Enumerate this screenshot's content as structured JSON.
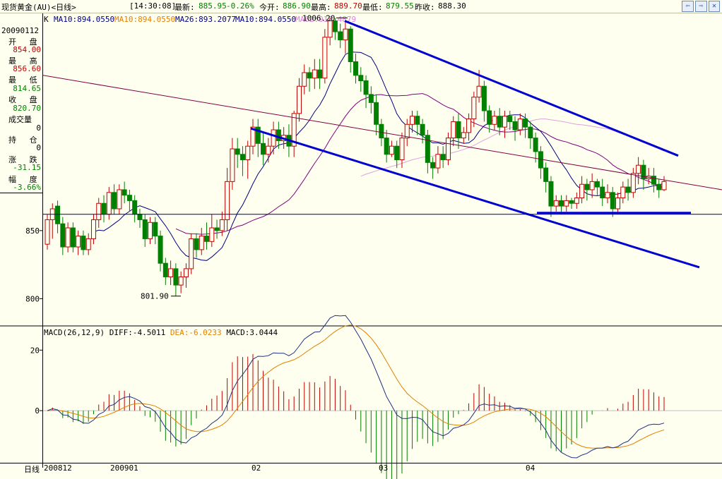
{
  "header": {
    "instrument": "现货黄金(AU)<日线>",
    "time": "[14:30:08]",
    "latest_label": "最新:",
    "latest_value": "885.95",
    "change_value": "-0.26%",
    "open_label": "今开:",
    "open_value": "886.90",
    "high_label": "最高:",
    "high_value": "889.70",
    "low_label": "最低:",
    "low_value": "879.55",
    "prev_label": "昨收:",
    "prev_value": "888.30"
  },
  "info_panel": {
    "date": "20090112",
    "open_label": "开 盘",
    "open_value": "854.00",
    "high_label": "最 高",
    "high_value": "856.60",
    "low_label": "最 低",
    "low_value": "814.65",
    "close_label": "收 盘",
    "close_value": "820.70",
    "volume_label": "成交量",
    "volume_value": "0",
    "oi_label": "持 仓",
    "oi_value": "0",
    "change_label": "涨 跌",
    "change_value": "-31.15",
    "amplitude_label": "幅 度",
    "amplitude_value": "-3.66%"
  },
  "ma_legend": [
    {
      "text": "K",
      "color": "#000000"
    },
    {
      "text": "MA10:894.0550",
      "color": "#000080"
    },
    {
      "text": "MA10:894.0550",
      "color": "#e08000"
    },
    {
      "text": "MA26:893.2077",
      "color": "#000080"
    },
    {
      "text": "MA10:894.0550",
      "color": "#000080"
    },
    {
      "text": "MA62:918.4879",
      "color": "#e080e0"
    }
  ],
  "macd_legend": {
    "name": "MACD(26,12,9)",
    "diff": "DIFF:-4.5011",
    "dea": "DEA:-6.0233",
    "macd": "MACD:3.0444"
  },
  "bottom_bar": {
    "period": "日线",
    "dates": [
      "200812",
      "200901",
      "02",
      "03",
      "04"
    ]
  },
  "chart_data": {
    "type": "candlestick",
    "price_axis": {
      "ticks": [
        800,
        850
      ],
      "ylim": [
        780,
        1010
      ]
    },
    "macd_axis": {
      "ticks": [
        0,
        20
      ],
      "ylim": [
        -17,
        28
      ]
    },
    "annotations": [
      {
        "text": "1006.20",
        "value": 1006.2
      },
      {
        "text": "801.90",
        "value": 801.9
      }
    ],
    "candles": [
      [
        840,
        858,
        836,
        862
      ],
      [
        858,
        866,
        844,
        870
      ],
      [
        868,
        855,
        848,
        872
      ],
      [
        855,
        838,
        832,
        860
      ],
      [
        838,
        852,
        834,
        856
      ],
      [
        852,
        838,
        834,
        856
      ],
      [
        838,
        846,
        832,
        850
      ],
      [
        846,
        836,
        832,
        850
      ],
      [
        836,
        844,
        832,
        848
      ],
      [
        844,
        858,
        840,
        862
      ],
      [
        858,
        870,
        852,
        874
      ],
      [
        870,
        862,
        856,
        876
      ],
      [
        862,
        878,
        858,
        882
      ],
      [
        878,
        866,
        862,
        884
      ],
      [
        866,
        880,
        862,
        884
      ],
      [
        880,
        876,
        870,
        886
      ],
      [
        876,
        872,
        864,
        880
      ],
      [
        872,
        862,
        856,
        876
      ],
      [
        862,
        858,
        852,
        866
      ],
      [
        858,
        844,
        838,
        862
      ],
      [
        844,
        856,
        840,
        860
      ],
      [
        856,
        846,
        840,
        860
      ],
      [
        846,
        826,
        820,
        850
      ],
      [
        826,
        816,
        810,
        830
      ],
      [
        816,
        822,
        810,
        828
      ],
      [
        822,
        810,
        802,
        826
      ],
      [
        810,
        816,
        804,
        820
      ],
      [
        816,
        822,
        808,
        826
      ],
      [
        822,
        844,
        818,
        848
      ],
      [
        844,
        836,
        830,
        848
      ],
      [
        836,
        846,
        832,
        852
      ],
      [
        846,
        842,
        836,
        856
      ],
      [
        842,
        852,
        838,
        862
      ],
      [
        852,
        850,
        844,
        858
      ],
      [
        850,
        858,
        846,
        864
      ],
      [
        858,
        886,
        850,
        896
      ],
      [
        886,
        910,
        880,
        918
      ],
      [
        910,
        906,
        896,
        918
      ],
      [
        906,
        902,
        890,
        912
      ],
      [
        902,
        912,
        888,
        916
      ],
      [
        912,
        926,
        906,
        932
      ],
      [
        926,
        914,
        904,
        932
      ],
      [
        914,
        906,
        898,
        922
      ],
      [
        906,
        912,
        900,
        918
      ],
      [
        912,
        924,
        906,
        930
      ],
      [
        924,
        916,
        910,
        930
      ],
      [
        916,
        920,
        910,
        926
      ],
      [
        920,
        912,
        904,
        928
      ],
      [
        912,
        936,
        904,
        938
      ],
      [
        936,
        956,
        930,
        962
      ],
      [
        956,
        966,
        950,
        972
      ],
      [
        966,
        962,
        952,
        970
      ],
      [
        962,
        968,
        954,
        976
      ],
      [
        968,
        962,
        954,
        976
      ],
      [
        962,
        992,
        958,
        998
      ],
      [
        992,
        1004,
        986,
        1006
      ],
      [
        1004,
        996,
        990,
        1006
      ],
      [
        996,
        990,
        984,
        1002
      ],
      [
        990,
        998,
        980,
        1004
      ],
      [
        998,
        974,
        966,
        1000
      ],
      [
        974,
        964,
        958,
        980
      ],
      [
        964,
        960,
        952,
        970
      ],
      [
        960,
        950,
        940,
        964
      ],
      [
        950,
        944,
        936,
        956
      ],
      [
        944,
        928,
        920,
        950
      ],
      [
        928,
        918,
        912,
        932
      ],
      [
        918,
        906,
        900,
        924
      ],
      [
        906,
        912,
        904,
        916
      ],
      [
        912,
        902,
        896,
        916
      ],
      [
        902,
        918,
        896,
        922
      ],
      [
        918,
        928,
        912,
        932
      ],
      [
        928,
        934,
        922,
        938
      ],
      [
        934,
        928,
        920,
        938
      ],
      [
        928,
        920,
        914,
        932
      ],
      [
        920,
        900,
        892,
        924
      ],
      [
        900,
        896,
        888,
        904
      ],
      [
        896,
        906,
        892,
        912
      ],
      [
        906,
        902,
        896,
        912
      ],
      [
        902,
        918,
        898,
        922
      ],
      [
        918,
        930,
        912,
        934
      ],
      [
        930,
        918,
        910,
        936
      ],
      [
        918,
        922,
        914,
        926
      ],
      [
        922,
        932,
        916,
        936
      ],
      [
        932,
        948,
        926,
        952
      ],
      [
        948,
        956,
        944,
        968
      ],
      [
        956,
        938,
        930,
        960
      ],
      [
        938,
        928,
        922,
        942
      ],
      [
        928,
        934,
        924,
        938
      ],
      [
        934,
        926,
        920,
        940
      ],
      [
        926,
        934,
        918,
        938
      ],
      [
        934,
        930,
        924,
        938
      ],
      [
        930,
        924,
        916,
        934
      ],
      [
        924,
        932,
        920,
        936
      ],
      [
        932,
        926,
        918,
        936
      ],
      [
        926,
        918,
        910,
        930
      ],
      [
        918,
        908,
        900,
        922
      ],
      [
        908,
        896,
        888,
        912
      ],
      [
        896,
        886,
        878,
        900
      ],
      [
        886,
        868,
        860,
        890
      ],
      [
        868,
        872,
        864,
        876
      ],
      [
        872,
        868,
        862,
        876
      ],
      [
        868,
        872,
        864,
        876
      ],
      [
        872,
        870,
        866,
        874
      ],
      [
        870,
        874,
        866,
        878
      ],
      [
        874,
        884,
        870,
        890
      ],
      [
        884,
        880,
        872,
        888
      ],
      [
        880,
        886,
        874,
        892
      ],
      [
        886,
        882,
        876,
        888
      ],
      [
        882,
        874,
        868,
        888
      ],
      [
        874,
        878,
        870,
        884
      ],
      [
        878,
        866,
        860,
        882
      ],
      [
        866,
        874,
        862,
        878
      ],
      [
        874,
        882,
        870,
        886
      ],
      [
        882,
        878,
        872,
        888
      ],
      [
        878,
        892,
        874,
        896
      ],
      [
        892,
        898,
        884,
        904
      ],
      [
        898,
        888,
        880,
        902
      ],
      [
        888,
        890,
        884,
        896
      ],
      [
        890,
        884,
        878,
        896
      ],
      [
        884,
        880,
        874,
        888
      ],
      [
        880,
        886,
        879,
        890
      ]
    ],
    "ma_short": [
      0
    ],
    "macd_hist": [
      0
    ]
  }
}
